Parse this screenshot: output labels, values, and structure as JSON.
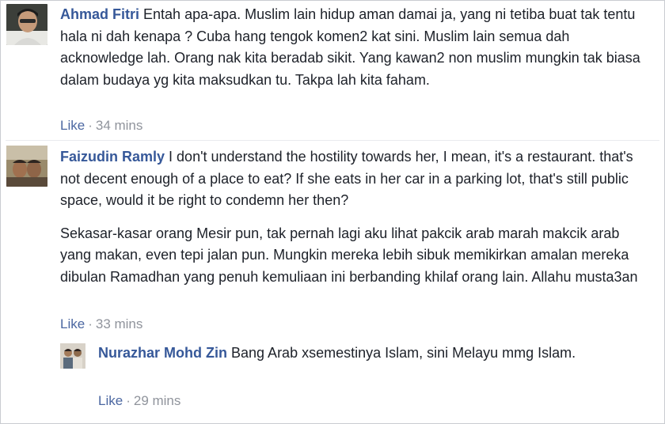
{
  "comments": [
    {
      "author": "Ahmad Fitri",
      "text": "Entah apa-apa. Muslim lain hidup aman damai ja, yang ni tetiba buat tak tentu hala ni dah kenapa ? Cuba hang tengok komen2 kat sini. Muslim lain semua dah acknowledge lah. Orang nak kita beradab sikit. Yang kawan2 non muslim mungkin tak biasa dalam budaya yg kita maksudkan tu. Takpa lah kita faham.",
      "like_label": "Like",
      "separator": "·",
      "time": "34 mins"
    },
    {
      "author": "Faizudin Ramly",
      "text": "I don't understand the hostility towards her, I mean, it's a restaurant. that's not decent enough of a place to eat? If she eats in her car in a parking lot, that's still public space, would it be right to condemn her then?",
      "text_p2": "Sekasar-kasar orang Mesir pun, tak pernah lagi aku lihat pakcik arab marah makcik arab yang makan, even tepi jalan pun. Mungkin mereka lebih sibuk memikirkan amalan mereka dibulan Ramadhan yang penuh kemuliaan ini berbanding khilaf orang lain. Allahu musta3an",
      "like_label": "Like",
      "separator": "·",
      "time": "33 mins"
    },
    {
      "author": "Nurazhar Mohd Zin",
      "text": "Bang Arab xsemestinya Islam, sini Melayu mmg Islam.",
      "like_label": "Like",
      "separator": "·",
      "time": "29 mins"
    }
  ],
  "colors": {
    "author": "#365899",
    "like": "#4b67a1",
    "meta": "#90949c",
    "text": "#1d2129"
  }
}
